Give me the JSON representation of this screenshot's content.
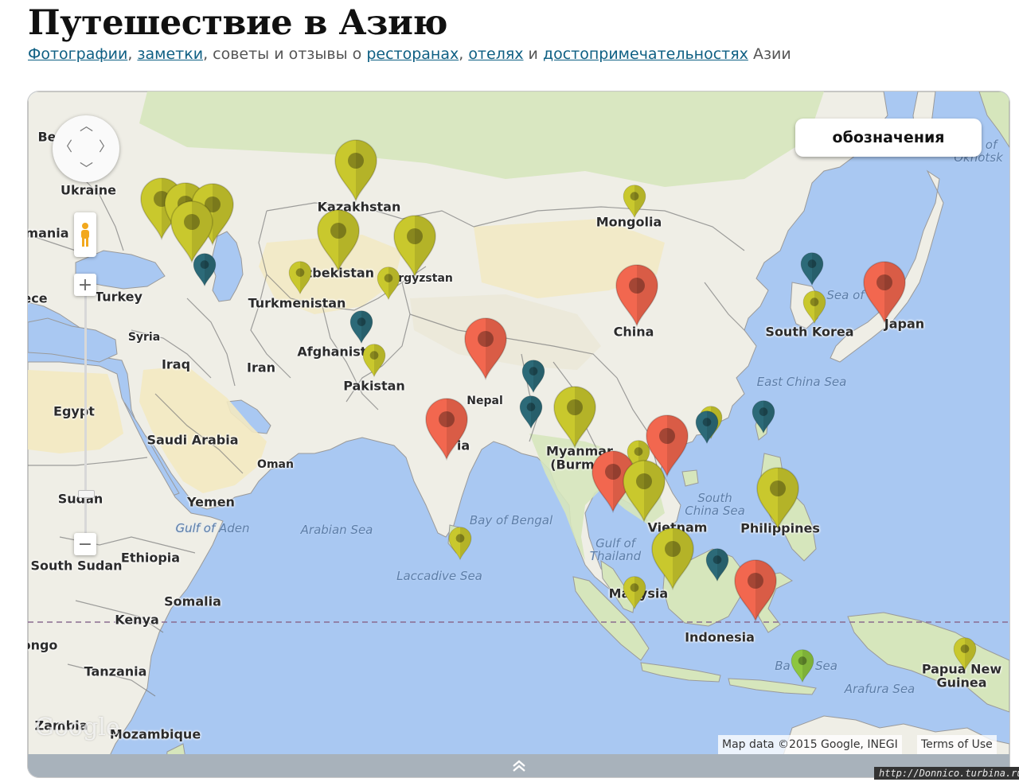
{
  "page": {
    "title": "Путешествие в Азию",
    "subtitle": {
      "links": [
        "Фотографии",
        "заметки",
        "ресторанах",
        "отелях",
        "достопримечательностях"
      ],
      "texts": [
        ", ",
        ", советы и отзывы о ",
        ", ",
        " и ",
        " Азии"
      ]
    }
  },
  "map": {
    "legend_button": "обозначения",
    "attribution": "Map data ©2015 Google, INEGI",
    "terms": "Terms of Use",
    "logo": "Google",
    "colors": {
      "land": "#efeee6",
      "desert": "#f3e9c1",
      "green": "#d6e6bc",
      "water": "#a9c8f2",
      "border": "#777777",
      "equator": "#8a6b8f",
      "pin_yellow": "#c9c82d",
      "pin_red": "#f2674f",
      "pin_teal": "#2c6a78",
      "pin_green": "#8dc63f"
    },
    "labels": [
      {
        "text": "Be",
        "kind": "land"
      },
      {
        "text": "Ukraine",
        "kind": "land"
      },
      {
        "text": "mania",
        "kind": "land"
      },
      {
        "text": "Kazakhstan",
        "kind": "land"
      },
      {
        "text": "Mongolia",
        "kind": "land"
      },
      {
        "text": "of",
        "kind": "water"
      },
      {
        "text": "Okhotsk",
        "kind": "water"
      },
      {
        "text": "Uzbekistan",
        "kind": "land"
      },
      {
        "text": "Kyrgyzstan",
        "kind": "land"
      },
      {
        "text": "ece",
        "kind": "land"
      },
      {
        "text": "Turkey",
        "kind": "land"
      },
      {
        "text": "Turkmenistan",
        "kind": "land"
      },
      {
        "text": "Sea of",
        "kind": "water"
      },
      {
        "text": "China",
        "kind": "land"
      },
      {
        "text": "South Korea",
        "kind": "land"
      },
      {
        "text": "Japan",
        "kind": "land"
      },
      {
        "text": "Syria",
        "kind": "land"
      },
      {
        "text": "Afghanistan",
        "kind": "land"
      },
      {
        "text": "Iraq",
        "kind": "land"
      },
      {
        "text": "Iran",
        "kind": "land"
      },
      {
        "text": "Pakistan",
        "kind": "land"
      },
      {
        "text": "East China Sea",
        "kind": "water"
      },
      {
        "text": "Nepal",
        "kind": "land"
      },
      {
        "text": "Egypt",
        "kind": "land"
      },
      {
        "text": "Saudi Arabia",
        "kind": "land"
      },
      {
        "text": "Myanmar",
        "kind": "land"
      },
      {
        "text": "(Burma)",
        "kind": "land"
      },
      {
        "text": "Oman",
        "kind": "land"
      },
      {
        "text": "ia",
        "kind": "land"
      },
      {
        "text": "Sudan",
        "kind": "land"
      },
      {
        "text": "Yemen",
        "kind": "land"
      },
      {
        "text": "South",
        "kind": "water"
      },
      {
        "text": "China Sea",
        "kind": "water"
      },
      {
        "text": "Gulf of Aden",
        "kind": "water"
      },
      {
        "text": "Arabian Sea",
        "kind": "water"
      },
      {
        "text": "Bay of Bengal",
        "kind": "water"
      },
      {
        "text": "Vietnam",
        "kind": "land"
      },
      {
        "text": "Philippines",
        "kind": "land"
      },
      {
        "text": "Gulf of",
        "kind": "water"
      },
      {
        "text": "Thailand",
        "kind": "water"
      },
      {
        "text": "Ethiopia",
        "kind": "land"
      },
      {
        "text": "South Sudan",
        "kind": "land"
      },
      {
        "text": "Laccadive Sea",
        "kind": "water"
      },
      {
        "text": "Ma",
        "kind": "land"
      },
      {
        "text": "ysia",
        "kind": "land"
      },
      {
        "text": "Somalia",
        "kind": "land"
      },
      {
        "text": "Kenya",
        "kind": "land"
      },
      {
        "text": "Indonesia",
        "kind": "land"
      },
      {
        "text": "ongo",
        "kind": "land"
      },
      {
        "text": "Tanzania",
        "kind": "land"
      },
      {
        "text": "Ba",
        "kind": "water"
      },
      {
        "text": "Sea",
        "kind": "water"
      },
      {
        "text": "Papua New",
        "kind": "land"
      },
      {
        "text": "Guinea",
        "kind": "land"
      },
      {
        "text": "Arafura Sea",
        "kind": "water"
      },
      {
        "text": "Zambia",
        "kind": "land"
      },
      {
        "text": "Mozambique",
        "kind": "land"
      }
    ],
    "markers": [
      {
        "color": "yellow",
        "size": "large",
        "near": "Kazakhstan"
      },
      {
        "color": "yellow",
        "size": "small",
        "near": "Mongolia"
      },
      {
        "color": "yellow",
        "size": "large",
        "near": "Georgia"
      },
      {
        "color": "yellow",
        "size": "large",
        "near": "Armenia"
      },
      {
        "color": "yellow",
        "size": "large",
        "near": "Azerbaijan"
      },
      {
        "color": "yellow",
        "size": "large",
        "near": "Caucasus"
      },
      {
        "color": "teal",
        "size": "small",
        "near": "Caspian Sea"
      },
      {
        "color": "yellow",
        "size": "large",
        "near": "Uzbekistan"
      },
      {
        "color": "yellow",
        "size": "large",
        "near": "Kyrgyzstan"
      },
      {
        "color": "yellow",
        "size": "small",
        "near": "Turkmenistan"
      },
      {
        "color": "yellow",
        "size": "small",
        "near": "Tajikistan"
      },
      {
        "color": "teal",
        "size": "small",
        "near": "Afghanistan"
      },
      {
        "color": "yellow",
        "size": "small",
        "near": "Pakistan"
      },
      {
        "color": "red",
        "size": "large",
        "near": "China"
      },
      {
        "color": "teal",
        "size": "small",
        "near": "North Korea"
      },
      {
        "color": "yellow",
        "size": "small",
        "near": "South Korea"
      },
      {
        "color": "red",
        "size": "large",
        "near": "Japan"
      },
      {
        "color": "red",
        "size": "large",
        "near": "Nepal"
      },
      {
        "color": "red",
        "size": "large",
        "near": "India"
      },
      {
        "color": "teal",
        "size": "small",
        "near": "Bhutan"
      },
      {
        "color": "teal",
        "size": "small",
        "near": "Bangladesh"
      },
      {
        "color": "yellow",
        "size": "large",
        "near": "Myanmar"
      },
      {
        "color": "yellow",
        "size": "small",
        "near": "Hong Kong"
      },
      {
        "color": "teal",
        "size": "small",
        "near": "Macau"
      },
      {
        "color": "teal",
        "size": "small",
        "near": "Taiwan"
      },
      {
        "color": "yellow",
        "size": "small",
        "near": "Laos"
      },
      {
        "color": "red",
        "size": "large",
        "near": "Vietnam"
      },
      {
        "color": "red",
        "size": "large",
        "near": "Thailand"
      },
      {
        "color": "yellow",
        "size": "large",
        "near": "Cambodia"
      },
      {
        "color": "yellow",
        "size": "large",
        "near": "Philippines"
      },
      {
        "color": "yellow",
        "size": "small",
        "near": "Sri Lanka"
      },
      {
        "color": "yellow",
        "size": "large",
        "near": "Malaysia"
      },
      {
        "color": "yellow",
        "size": "small",
        "near": "Singapore"
      },
      {
        "color": "teal",
        "size": "small",
        "near": "Brunei"
      },
      {
        "color": "red",
        "size": "large",
        "near": "Indonesia"
      },
      {
        "color": "green",
        "size": "small",
        "near": "Bali"
      },
      {
        "color": "yellow",
        "size": "small",
        "near": "Papua New Guinea"
      }
    ]
  },
  "watermark": "http://Donnico.turbina.ru"
}
